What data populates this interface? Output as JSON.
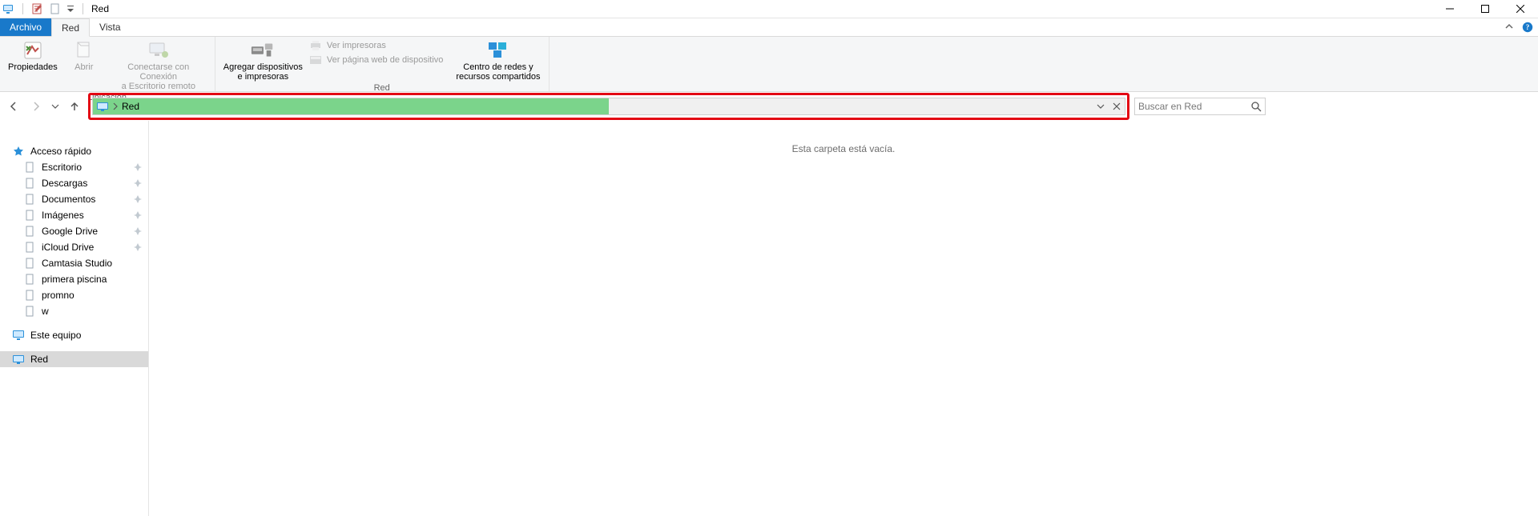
{
  "window": {
    "title": "Red"
  },
  "tabs": {
    "file": "Archivo",
    "network": "Red",
    "view": "Vista"
  },
  "ribbon": {
    "group_location": "Ubicación",
    "group_network": "Red",
    "properties": "Propiedades",
    "open": "Abrir",
    "rdp": "Conectarse con Conexión\na Escritorio remoto",
    "add_devices": "Agregar dispositivos\ne impresoras",
    "view_printers": "Ver impresoras",
    "view_device_page": "Ver página web de dispositivo",
    "network_center": "Centro de redes y\nrecursos compartidos"
  },
  "address": {
    "location": "Red"
  },
  "search": {
    "placeholder": "Buscar en Red"
  },
  "sidebar": {
    "quick_access": "Acceso rápido",
    "items": [
      {
        "label": "Escritorio",
        "pin": true
      },
      {
        "label": "Descargas",
        "pin": true
      },
      {
        "label": "Documentos",
        "pin": true
      },
      {
        "label": "Imágenes",
        "pin": true
      },
      {
        "label": "Google Drive",
        "pin": true
      },
      {
        "label": "iCloud Drive",
        "pin": true
      },
      {
        "label": "Camtasia Studio",
        "pin": false
      },
      {
        "label": "primera piscina",
        "pin": false
      },
      {
        "label": "promno",
        "pin": false
      },
      {
        "label": "w",
        "pin": false
      }
    ],
    "this_pc": "Este equipo",
    "network": "Red"
  },
  "content": {
    "empty": "Esta carpeta está vacía."
  }
}
